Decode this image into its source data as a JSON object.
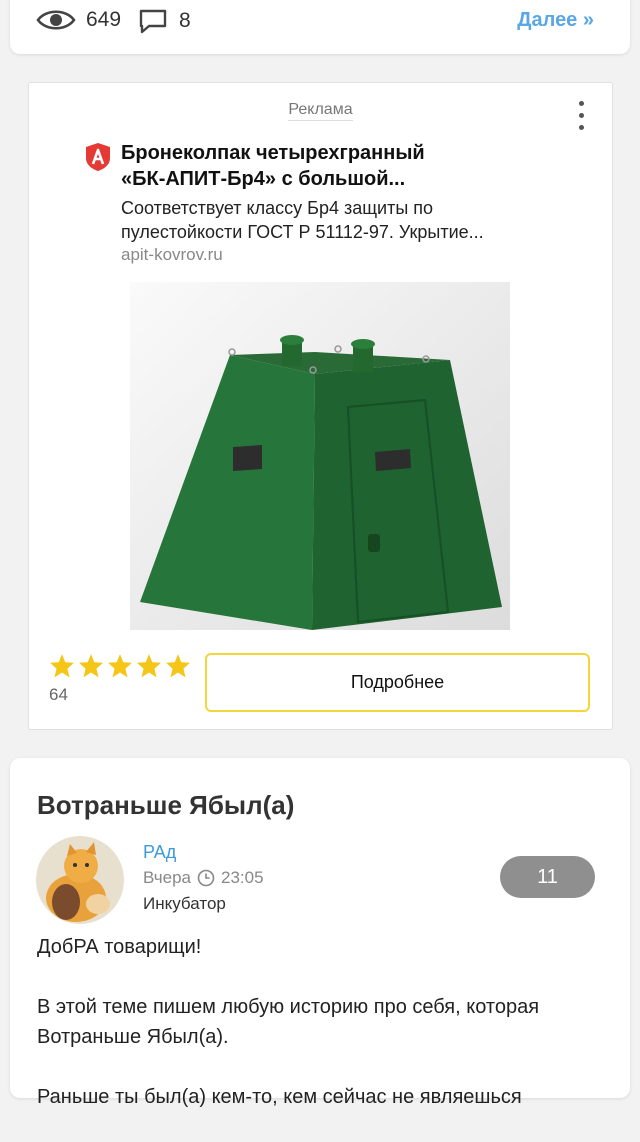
{
  "top_card": {
    "views": "649",
    "comments": "8",
    "more_label": "Далее »"
  },
  "ad": {
    "label": "Реклама",
    "title_line1": "Бронеколпак четырехгранный",
    "title_line2": "«БК-АПИТ-Бр4» с большой...",
    "desc_line1": "Соответствует классу Бр4 защиты по",
    "desc_line2": "пулестойкости ГОСТ Р 51112-97. Укрытие...",
    "domain": "apit-kovrov.ru",
    "rating_stars": 5,
    "rating_count": "64",
    "button_label": "Подробнее",
    "colors": {
      "star": "#f5c518",
      "button_border": "#f4d63a",
      "logo": "#e53935"
    }
  },
  "post": {
    "title": "Вотраньше Ябыл(а)",
    "author": "РАд",
    "date": "Вчера",
    "time": "23:05",
    "group": "Инкубатор",
    "comments_count": "11",
    "body": [
      "ДобРА товарищи!",
      "В этой теме пишем любую историю про себя, которая Вотраньше Ябыл(а).",
      "Раньше ты был(а) кем-то, кем сейчас не являешься"
    ]
  },
  "icons": [
    "eye-icon",
    "comment-icon",
    "ad-brand-logo-icon",
    "more-vertical-icon",
    "star-icon",
    "clock-icon"
  ]
}
